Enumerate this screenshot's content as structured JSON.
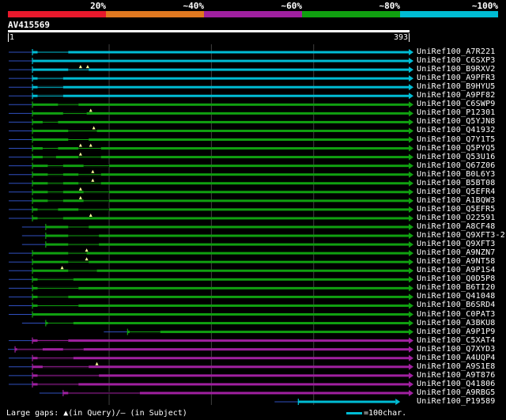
{
  "colors": {
    "background": "#000000",
    "query": "#ffffff",
    "identity_20": "#e8192c",
    "identity_40": "#e07820",
    "identity_60": "#a020a0",
    "identity_80": "#10a010",
    "identity_100": "#00bcd4",
    "stub": "#3050c0",
    "gap_marker": "#ffff99",
    "grid": "#404040"
  },
  "legend": {
    "labels": [
      "20%",
      "~40%",
      "~60%",
      "~80%",
      "~100%"
    ],
    "segment_color_keys": [
      "identity_20",
      "identity_40",
      "identity_60",
      "identity_80",
      "identity_100"
    ]
  },
  "query": {
    "name": "AV415569",
    "start": "1",
    "end": "393",
    "length": 393
  },
  "hits": [
    {
      "name": "UniRef100_A7R221",
      "color": "identity_100",
      "start": 25,
      "end": 393,
      "arrow": true,
      "gaps": [],
      "thin": [
        [
          30,
          60
        ]
      ]
    },
    {
      "name": "UniRef100_C6SXP3",
      "color": "identity_100",
      "start": 25,
      "end": 393,
      "arrow": true,
      "gaps": [],
      "thin": []
    },
    {
      "name": "UniRef100_B9RXV2",
      "color": "identity_100",
      "start": 25,
      "end": 393,
      "arrow": true,
      "gaps": [
        72,
        79
      ],
      "thin": [
        [
          60,
          80
        ]
      ]
    },
    {
      "name": "UniRef100_A9PFR3",
      "color": "identity_100",
      "start": 25,
      "end": 393,
      "arrow": true,
      "gaps": [],
      "thin": [
        [
          30,
          55
        ]
      ]
    },
    {
      "name": "UniRef100_B9HYU5",
      "color": "identity_100",
      "start": 25,
      "end": 393,
      "arrow": true,
      "gaps": [],
      "thin": [
        [
          30,
          55
        ]
      ]
    },
    {
      "name": "UniRef100_A9PF82",
      "color": "identity_100",
      "start": 25,
      "end": 393,
      "arrow": true,
      "gaps": [],
      "thin": [
        [
          30,
          55
        ]
      ]
    },
    {
      "name": "UniRef100_C6SWP9",
      "color": "identity_80",
      "start": 25,
      "end": 393,
      "arrow": true,
      "gaps": [],
      "thin": [
        [
          50,
          70
        ]
      ]
    },
    {
      "name": "UniRef100_P12301",
      "color": "identity_80",
      "start": 25,
      "end": 393,
      "arrow": true,
      "gaps": [
        82
      ],
      "thin": [
        [
          55,
          78
        ]
      ]
    },
    {
      "name": "UniRef100_Q5YJN8",
      "color": "identity_80",
      "start": 25,
      "end": 393,
      "arrow": true,
      "gaps": [],
      "thin": [
        [
          35,
          50
        ]
      ]
    },
    {
      "name": "UniRef100_Q41932",
      "color": "identity_80",
      "start": 25,
      "end": 393,
      "arrow": true,
      "gaps": [
        85
      ],
      "thin": [
        [
          60,
          88
        ]
      ]
    },
    {
      "name": "UniRef100_Q7Y1T5",
      "color": "identity_80",
      "start": 25,
      "end": 393,
      "arrow": true,
      "gaps": [],
      "thin": [
        [
          60,
          80
        ]
      ]
    },
    {
      "name": "UniRef100_Q5PYQ5",
      "color": "identity_80",
      "start": 25,
      "end": 393,
      "arrow": true,
      "gaps": [
        72,
        82
      ],
      "thin": [
        [
          35,
          50
        ],
        [
          70,
          92
        ]
      ]
    },
    {
      "name": "UniRef100_Q53U16",
      "color": "identity_80",
      "start": 25,
      "end": 393,
      "arrow": true,
      "gaps": [
        72
      ],
      "thin": [
        [
          35,
          48
        ],
        [
          70,
          92
        ]
      ]
    },
    {
      "name": "UniRef100_Q67Z06",
      "color": "identity_80",
      "start": 25,
      "end": 393,
      "arrow": true,
      "gaps": [],
      "thin": [
        [
          40,
          55
        ],
        [
          75,
          100
        ]
      ]
    },
    {
      "name": "UniRef100_B0L6Y3",
      "color": "identity_80",
      "start": 25,
      "end": 393,
      "arrow": true,
      "gaps": [
        84
      ],
      "thin": [
        [
          40,
          55
        ],
        [
          70,
          92
        ]
      ]
    },
    {
      "name": "UniRef100_B5BT08",
      "color": "identity_80",
      "start": 25,
      "end": 393,
      "arrow": true,
      "gaps": [
        84
      ],
      "thin": [
        [
          40,
          55
        ],
        [
          70,
          92
        ]
      ]
    },
    {
      "name": "UniRef100_Q5EFR4",
      "color": "identity_80",
      "start": 25,
      "end": 393,
      "arrow": true,
      "gaps": [
        72
      ],
      "thin": [
        [
          40,
          55
        ],
        [
          75,
          100
        ]
      ]
    },
    {
      "name": "UniRef100_A1BQW3",
      "color": "identity_80",
      "start": 25,
      "end": 393,
      "arrow": true,
      "gaps": [
        72
      ],
      "thin": [
        [
          40,
          55
        ],
        [
          75,
          100
        ]
      ]
    },
    {
      "name": "UniRef100_Q5EFR5",
      "color": "identity_80",
      "start": 25,
      "end": 393,
      "arrow": true,
      "gaps": [],
      "thin": [
        [
          30,
          50
        ],
        [
          70,
          100
        ]
      ]
    },
    {
      "name": "UniRef100_O22591",
      "color": "identity_80",
      "start": 25,
      "end": 393,
      "arrow": true,
      "gaps": [
        82
      ],
      "thin": [
        [
          30,
          55
        ]
      ]
    },
    {
      "name": "UniRef100_A8CF48",
      "color": "identity_80",
      "start": 38,
      "end": 393,
      "arrow": true,
      "gaps": [],
      "thin": [
        [
          60,
          80
        ]
      ]
    },
    {
      "name": "UniRef100_Q9XFT3-2",
      "color": "identity_80",
      "start": 38,
      "end": 393,
      "arrow": true,
      "gaps": [],
      "thin": [
        [
          60,
          90
        ]
      ]
    },
    {
      "name": "UniRef100_Q9XFT3",
      "color": "identity_80",
      "start": 38,
      "end": 393,
      "arrow": true,
      "gaps": [],
      "thin": [
        [
          60,
          90
        ]
      ]
    },
    {
      "name": "UniRef100_A9NZN7",
      "color": "identity_80",
      "start": 25,
      "end": 393,
      "arrow": true,
      "gaps": [
        78
      ],
      "thin": [
        [
          60,
          78
        ]
      ]
    },
    {
      "name": "UniRef100_A9NT58",
      "color": "identity_80",
      "start": 25,
      "end": 393,
      "arrow": true,
      "gaps": [
        78
      ],
      "thin": [
        [
          60,
          80
        ]
      ]
    },
    {
      "name": "UniRef100_A9P1S4",
      "color": "identity_80",
      "start": 25,
      "end": 393,
      "arrow": true,
      "gaps": [
        54
      ],
      "thin": [
        [
          60,
          88
        ]
      ]
    },
    {
      "name": "UniRef100_Q0D5P8",
      "color": "identity_80",
      "start": 25,
      "end": 393,
      "arrow": true,
      "gaps": [],
      "thin": [
        [
          30,
          65
        ]
      ]
    },
    {
      "name": "UniRef100_B6TI20",
      "color": "identity_80",
      "start": 25,
      "end": 393,
      "arrow": true,
      "gaps": [],
      "thin": [
        [
          30,
          70
        ]
      ]
    },
    {
      "name": "UniRef100_Q41048",
      "color": "identity_80",
      "start": 25,
      "end": 393,
      "arrow": true,
      "gaps": [],
      "thin": [
        [
          30,
          60
        ]
      ]
    },
    {
      "name": "UniRef100_B6SRD4",
      "color": "identity_80",
      "start": 25,
      "end": 393,
      "arrow": true,
      "gaps": [],
      "thin": [
        [
          30,
          70
        ]
      ]
    },
    {
      "name": "UniRef100_C0PAT3",
      "color": "identity_80",
      "start": 25,
      "end": 393,
      "arrow": true,
      "gaps": [],
      "thin": []
    },
    {
      "name": "UniRef100_A3BKU8",
      "color": "identity_80",
      "start": 38,
      "end": 393,
      "arrow": true,
      "gaps": [],
      "thin": [
        [
          40,
          65
        ]
      ]
    },
    {
      "name": "UniRef100_A9P1P9",
      "color": "identity_80",
      "start": 118,
      "end": 393,
      "arrow": true,
      "gaps": [],
      "thin": [
        [
          120,
          150
        ]
      ]
    },
    {
      "name": "UniRef100_C5XAT4",
      "color": "identity_60",
      "start": 25,
      "end": 393,
      "arrow": true,
      "gaps": [],
      "thin": [
        [
          30,
          60
        ]
      ]
    },
    {
      "name": "UniRef100_Q7XYD3",
      "color": "identity_60",
      "start": 8,
      "end": 393,
      "arrow": true,
      "gaps": [],
      "thin": [
        [
          10,
          35
        ],
        [
          55,
          75
        ]
      ]
    },
    {
      "name": "UniRef100_A4UQP4",
      "color": "identity_60",
      "start": 25,
      "end": 393,
      "arrow": true,
      "gaps": [],
      "thin": [
        [
          30,
          65
        ]
      ]
    },
    {
      "name": "UniRef100_A9S1E8",
      "color": "identity_60",
      "start": 25,
      "end": 393,
      "arrow": true,
      "gaps": [
        88
      ],
      "thin": [
        [
          35,
          80
        ]
      ]
    },
    {
      "name": "UniRef100_A9T876",
      "color": "identity_60",
      "start": 25,
      "end": 393,
      "arrow": true,
      "gaps": [],
      "thin": [
        [
          30,
          90
        ]
      ]
    },
    {
      "name": "UniRef100_Q41806",
      "color": "identity_60",
      "start": 25,
      "end": 393,
      "arrow": true,
      "gaps": [],
      "thin": [
        [
          30,
          70
        ]
      ]
    },
    {
      "name": "UniRef100_A9RBG5",
      "color": "identity_60",
      "start": 55,
      "end": 393,
      "arrow": true,
      "gaps": [],
      "thin": [
        [
          60,
          130
        ]
      ]
    },
    {
      "name": "UniRef100_P19589",
      "color": "identity_100",
      "start": 285,
      "end": 380,
      "arrow": true,
      "gaps": [],
      "thin": []
    }
  ],
  "footer": {
    "gaps_text": "Large gaps: ▲(in Query)/– (in Subject)",
    "key_text": "=100char."
  }
}
